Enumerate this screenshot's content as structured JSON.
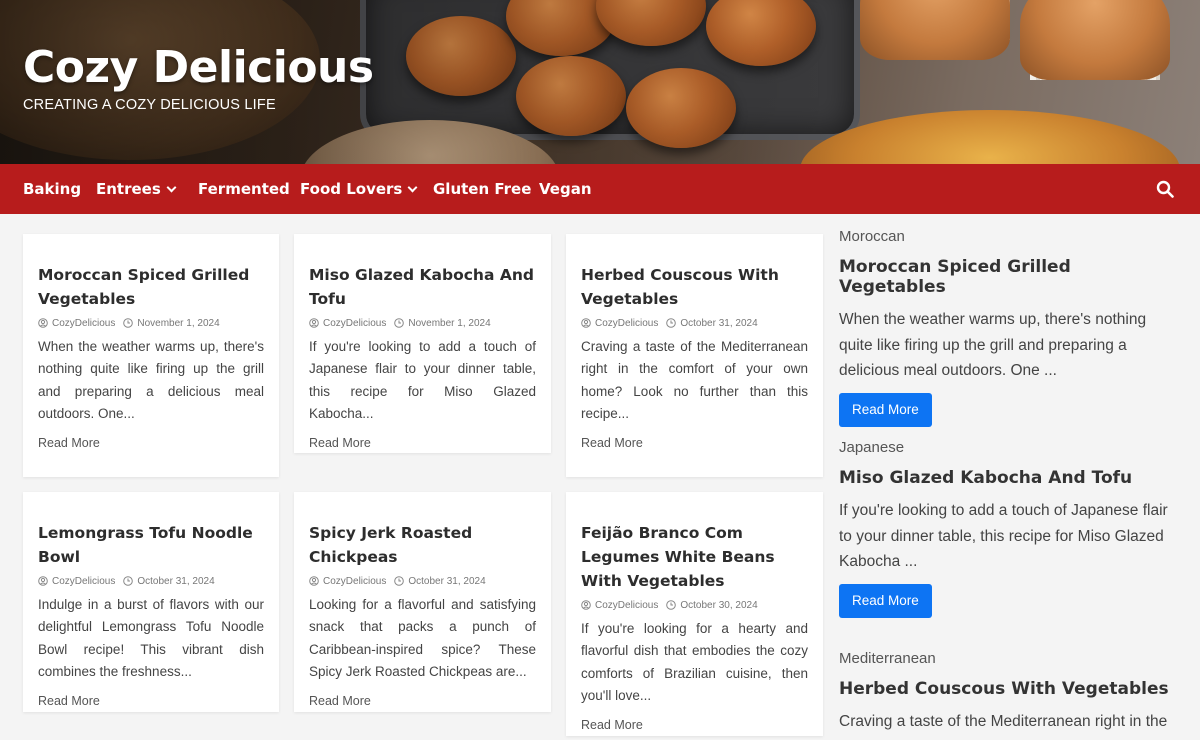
{
  "header": {
    "title": "Cozy Delicious",
    "tagline": "CREATING A COZY DELICIOUS LIFE"
  },
  "nav": {
    "items": [
      {
        "label": "Baking"
      },
      {
        "label": "Entrees"
      },
      {
        "label": "Fermented"
      },
      {
        "label": "Food Lovers"
      },
      {
        "label": "Gluten Free"
      },
      {
        "label": "Vegan"
      }
    ]
  },
  "posts": [
    {
      "title": "Moroccan Spiced Grilled Vegetables",
      "author": "CozyDelicious",
      "date": "November 1, 2024",
      "excerpt": "When the weather warms up, there's nothing quite like firing up the grill and preparing a delicious meal outdoors. One...",
      "read_more": "Read More"
    },
    {
      "title": "Miso Glazed Kabocha And Tofu",
      "author": "CozyDelicious",
      "date": "November 1, 2024",
      "excerpt": "If you're looking to add a touch of Japanese flair to your dinner table, this recipe for Miso Glazed Kabocha...",
      "read_more": "Read More"
    },
    {
      "title": "Herbed Couscous With Vegetables",
      "author": "CozyDelicious",
      "date": "October 31, 2024",
      "excerpt": "Craving a taste of the Mediterranean right in the comfort of your own home? Look no further than this recipe...",
      "read_more": "Read More"
    },
    {
      "title": "Lemongrass Tofu Noodle Bowl",
      "author": "CozyDelicious",
      "date": "October 31, 2024",
      "excerpt": "Indulge in a burst of flavors with our delightful Lemongrass Tofu Noodle Bowl recipe! This vibrant dish combines the freshness...",
      "read_more": "Read More"
    },
    {
      "title": "Spicy Jerk Roasted Chickpeas",
      "author": "CozyDelicious",
      "date": "October 31, 2024",
      "excerpt": "Looking for a flavorful and satisfying snack that packs a punch of Caribbean-inspired spice? These Spicy Jerk Roasted Chickpeas are...",
      "read_more": "Read More"
    },
    {
      "title": "Feijão Branco Com Legumes White Beans With Vegetables",
      "author": "CozyDelicious",
      "date": "October 30, 2024",
      "excerpt": "If you're looking for a hearty and flavorful dish that embodies the cozy comforts of Brazilian cuisine, then you'll love...",
      "read_more": "Read More"
    }
  ],
  "sidebar": [
    {
      "category": "Moroccan",
      "title": "Moroccan Spiced Grilled Vegetables",
      "excerpt": "When the weather warms up, there's nothing quite like firing up the grill and preparing a delicious meal outdoors. One ...",
      "button": "Read More"
    },
    {
      "category": "Japanese",
      "title": "Miso Glazed Kabocha And Tofu",
      "excerpt": "If you're looking to add a touch of Japanese flair to your dinner table, this recipe for Miso Glazed Kabocha ...",
      "button": "Read More"
    },
    {
      "category": "Mediterranean",
      "title": "Herbed Couscous With Vegetables",
      "excerpt": "Craving a taste of the Mediterranean right in the"
    }
  ],
  "colors": {
    "nav_bg": "#b71c1c",
    "button_bg": "#0d74f3",
    "page_bg": "#f4f4f4"
  },
  "icons": {
    "search": "search-icon",
    "author": "user-icon",
    "date": "clock-icon",
    "dropdown": "chevron-down-icon"
  }
}
